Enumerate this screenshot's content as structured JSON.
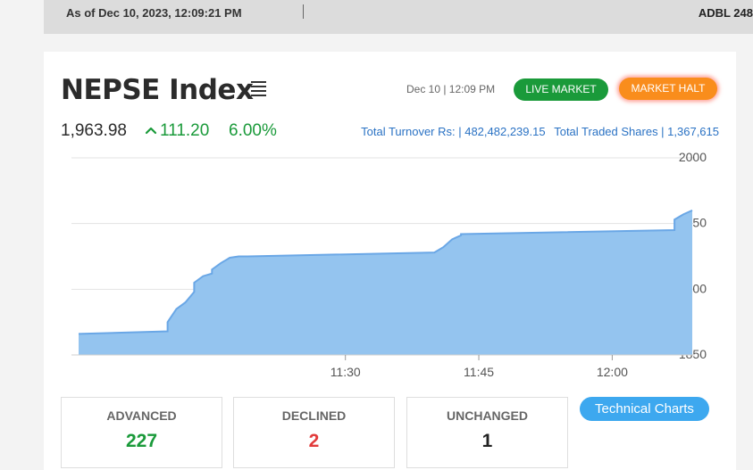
{
  "topbar": {
    "as_of": "As of Dec 10, 2023, 12:09:21 PM",
    "ticker_text": "ADBL 248"
  },
  "index": {
    "title": "NEPSE Index",
    "datetime": "Dec 10 | 12:09 PM",
    "live_label": "LIVE MARKET",
    "halt_label": "MARKET HALT",
    "value": "1,963.98",
    "change": "111.20",
    "change_pct": "6.00%",
    "turnover": "Total Turnover Rs: | 482,482,239.15",
    "traded_shares": "Total Traded Shares | 1,367,615"
  },
  "colors": {
    "positive": "#1a9a3a",
    "negative": "#e23b3b",
    "neutral": "#222222",
    "halt": "#f98d1c",
    "area_fill": "#94c4ef",
    "area_line": "#6aa7e6"
  },
  "chart_data": {
    "type": "area",
    "x_ticks": [
      "11:30",
      "11:45",
      "12:00"
    ],
    "y_ticks": [
      1850,
      1900,
      1950,
      2000
    ],
    "ylim": [
      1850,
      2000
    ],
    "xlim": [
      "11:00",
      "12:09"
    ],
    "grid": true,
    "series": [
      {
        "x": [
          "11:00",
          "11:10",
          "11:10",
          "11:11",
          "11:12",
          "11:13",
          "11:13",
          "11:14",
          "11:15",
          "11:15",
          "11:16",
          "11:17",
          "11:18",
          "11:18",
          "11:19",
          "11:40",
          "11:41",
          "11:42",
          "11:43",
          "11:43",
          "12:07",
          "12:07",
          "12:08",
          "12:09"
        ],
        "values": [
          1866,
          1868,
          1875,
          1885,
          1890,
          1898,
          1905,
          1910,
          1912,
          1915,
          1920,
          1924,
          1925,
          1925,
          1925,
          1928,
          1932,
          1938,
          1941,
          1942,
          1945,
          1953,
          1957,
          1960
        ]
      }
    ]
  },
  "stats": {
    "advanced_label": "ADVANCED",
    "advanced_value": "227",
    "declined_label": "DECLINED",
    "declined_value": "2",
    "unchanged_label": "UNCHANGED",
    "unchanged_value": "1"
  },
  "icons": {
    "menu": "hamburger-menu-icon",
    "change": "chevron-up-icon"
  },
  "technical_charts_label": "Technical Charts"
}
